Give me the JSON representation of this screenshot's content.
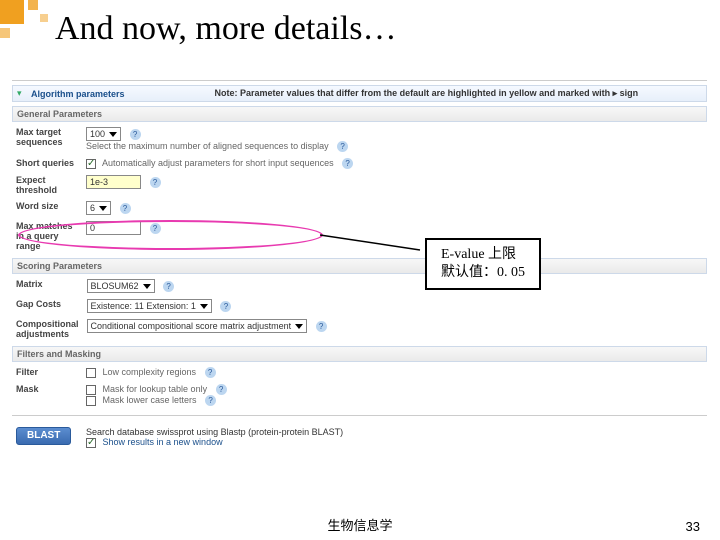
{
  "slide": {
    "title": "And now, more details…",
    "footer_text": "生物信息学",
    "page_number": "33"
  },
  "algo": {
    "header": "Algorithm parameters",
    "note": "Note: Parameter values that differ from the default are highlighted in yellow and marked with ▸ sign"
  },
  "general": {
    "header": "General Parameters",
    "max_target_label": "Max target\nsequences",
    "max_target_value": "100",
    "max_target_desc": "Select the maximum number of aligned sequences to display",
    "short_queries_label": "Short queries",
    "short_queries_desc": "Automatically adjust parameters for short input sequences",
    "expect_label": "Expect\nthreshold",
    "expect_value": "1e-3",
    "word_size_label": "Word size",
    "word_size_value": "6",
    "max_matches_label": "Max matches\nin a query\nrange",
    "max_matches_value": "0"
  },
  "scoring": {
    "header": "Scoring Parameters",
    "matrix_label": "Matrix",
    "matrix_value": "BLOSUM62",
    "gap_label": "Gap Costs",
    "gap_value": "Existence: 11 Extension: 1",
    "comp_label": "Compositional\nadjustments",
    "comp_value": "Conditional compositional score matrix adjustment"
  },
  "filters": {
    "header": "Filters and Masking",
    "filter_label": "Filter",
    "filter_value": "Low complexity regions",
    "mask_label": "Mask",
    "mask_lookup": "Mask for lookup table only",
    "mask_lower": "Mask lower case letters"
  },
  "run": {
    "button": "BLAST",
    "desc": "Search database swissprot using Blastp (protein-protein BLAST)",
    "show_new": "Show results in a new window"
  },
  "callout": {
    "line1": "E-value 上限",
    "line2": "默认值：0. 05"
  }
}
